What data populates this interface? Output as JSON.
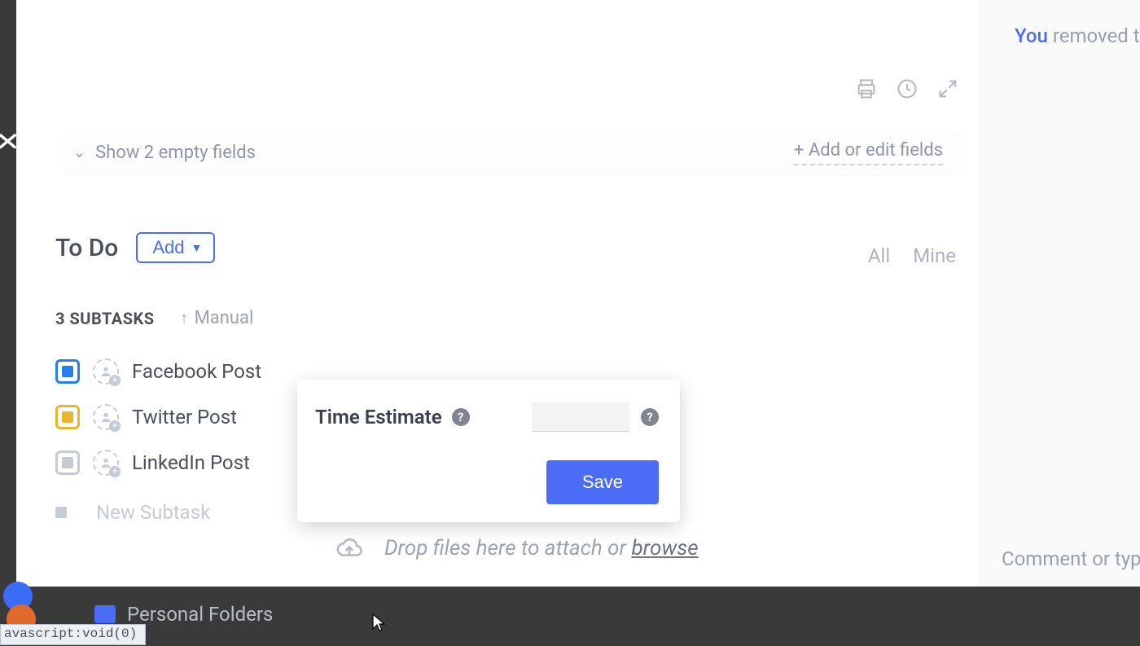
{
  "close_label": "✕",
  "activity": {
    "you": "You",
    "rest": "removed th"
  },
  "toolbar_icons": {
    "print": "print-icon",
    "history": "history-icon",
    "expand": "expand-icon"
  },
  "fields_row": {
    "show_text": "Show 2 empty fields",
    "add_edit": "+ Add or edit fields"
  },
  "todo": {
    "title": "To Do",
    "add_label": "Add",
    "filter_all": "All",
    "filter_mine": "Mine"
  },
  "subtasks": {
    "count_label": "3 SUBTASKS",
    "sort_label": "Manual",
    "items": [
      {
        "name": "Facebook Post",
        "status_color": "blue"
      },
      {
        "name": "Twitter Post",
        "status_color": "yellow"
      },
      {
        "name": "LinkedIn Post",
        "status_color": "gray"
      }
    ],
    "new_placeholder": "New Subtask"
  },
  "popover": {
    "label": "Time Estimate",
    "input_value": "",
    "save_label": "Save"
  },
  "dropzone": {
    "text": "Drop files here to attach or ",
    "browse": "browse"
  },
  "comment_placeholder": "Comment or typ",
  "bottom": {
    "folder_label": "Personal Folders"
  },
  "statusbar": {
    "js_void": "avascript:void(0)"
  }
}
